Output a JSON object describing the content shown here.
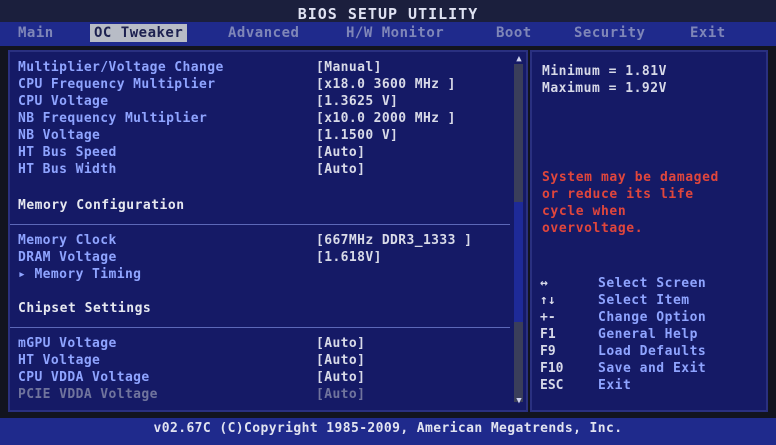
{
  "title": "BIOS SETUP UTILITY",
  "menu": [
    "Main",
    "OC Tweaker",
    "Advanced",
    "H/W Monitor",
    "Boot",
    "Security",
    "Exit"
  ],
  "settings": [
    {
      "label": "Multiplier/Voltage Change",
      "value": "[Manual]"
    },
    {
      "label": "CPU Frequency Multiplier",
      "value": "[x18.0 3600 MHz ]"
    },
    {
      "label": "CPU Voltage",
      "value": "[1.3625 V]"
    },
    {
      "label": "NB Frequency Multiplier",
      "value": "[x10.0 2000 MHz ]"
    },
    {
      "label": "NB Voltage",
      "value": "[1.1500 V]"
    },
    {
      "label": "HT Bus Speed",
      "value": "[Auto]"
    },
    {
      "label": "HT Bus Width",
      "value": "[Auto]"
    }
  ],
  "memory": {
    "heading": "Memory Configuration",
    "items": [
      {
        "label": "Memory Clock",
        "value": "[667MHz DDR3_1333 ]"
      },
      {
        "label": "DRAM Voltage",
        "value": "[1.618V]"
      },
      {
        "label": "▸ Memory Timing",
        "value": ""
      }
    ]
  },
  "chipset": {
    "heading": "Chipset Settings",
    "items": [
      {
        "label": "mGPU Voltage",
        "value": "[Auto]"
      },
      {
        "label": "HT Voltage",
        "value": "[Auto]"
      },
      {
        "label": "CPU VDDA Voltage",
        "value": "[Auto]"
      },
      {
        "label": "PCIE VDDA Voltage",
        "value": "[Auto]"
      }
    ]
  },
  "info": {
    "minimum": "Minimum    = 1.81V",
    "maximum": "Maximum    = 1.92V",
    "warning": [
      "System may be damaged",
      "or reduce its life",
      "cycle  when",
      "overvoltage."
    ]
  },
  "help": [
    {
      "key": "↔",
      "text": "Select Screen"
    },
    {
      "key": "↑↓",
      "text": "Select Item"
    },
    {
      "key": "+-",
      "text": "Change Option"
    },
    {
      "key": "F1",
      "text": "General Help"
    },
    {
      "key": "F9",
      "text": "Load Defaults"
    },
    {
      "key": "F10",
      "text": "Save and Exit"
    },
    {
      "key": "ESC",
      "text": "Exit"
    }
  ],
  "footer": "v02.67C (C)Copyright 1985-2009, American Megatrends, Inc."
}
